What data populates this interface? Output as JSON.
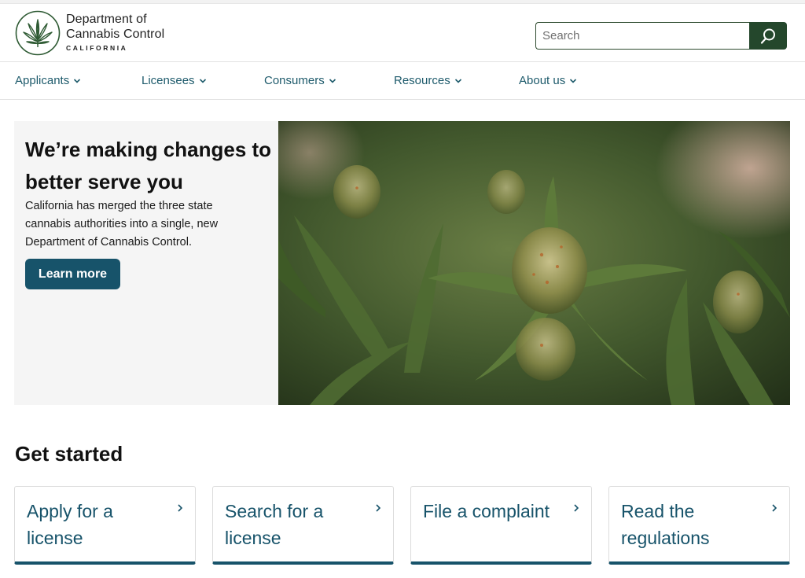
{
  "header": {
    "brand_line1": "Department of",
    "brand_line2": "Cannabis Control",
    "brand_sub": "CALIFORNIA",
    "logo_icon": "cannabis-leaf-icon",
    "search": {
      "placeholder": "Search",
      "value": "",
      "button_icon": "search-icon"
    }
  },
  "nav": {
    "items": [
      {
        "label": "Applicants"
      },
      {
        "label": "Licensees"
      },
      {
        "label": "Consumers"
      },
      {
        "label": "Resources"
      },
      {
        "label": "About us"
      }
    ],
    "chevron_icon": "chevron-down-icon"
  },
  "hero": {
    "title": "We’re making changes to better serve you",
    "body": "California has merged the three state cannabis authorities into a single, new Department of Cannabis Control.",
    "button_label": "Learn more"
  },
  "get_started": {
    "heading": "Get started",
    "cards": [
      {
        "label": "Apply for a license"
      },
      {
        "label": "Search for a license"
      },
      {
        "label": "File a complaint"
      },
      {
        "label": "Read the regulations"
      }
    ],
    "chevron_icon": "chevron-right-icon"
  },
  "colors": {
    "brand_green": "#24472c",
    "link_teal": "#1d5a6b",
    "button_teal": "#17536a",
    "hero_panel": "#f5f5f5"
  }
}
